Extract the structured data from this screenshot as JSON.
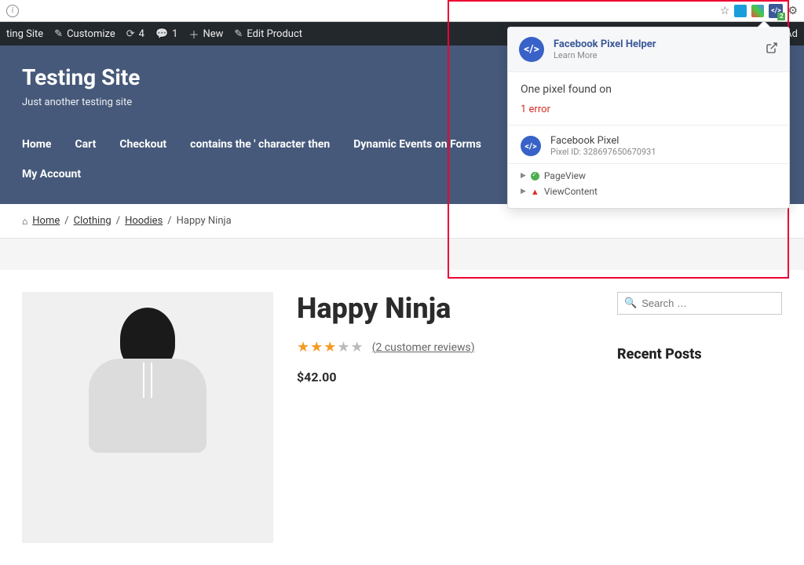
{
  "browser": {
    "pixel_ext_count": "2"
  },
  "admin_bar": {
    "site": "ting Site",
    "customize": "Customize",
    "updates": "4",
    "comments": "1",
    "new": "New",
    "edit": "Edit Product",
    "howdy": "y, Ad"
  },
  "site": {
    "title": "Testing Site",
    "tagline": "Just another testing site",
    "nav": [
      "Home",
      "Cart",
      "Checkout",
      "contains the ' character then",
      "Dynamic Events on Forms"
    ],
    "nav2": [
      "My Account"
    ]
  },
  "breadcrumb": {
    "home": "Home",
    "clothing": "Clothing",
    "hoodies": "Hoodies",
    "current": "Happy Ninja"
  },
  "product": {
    "title": "Happy Ninja",
    "review_link": "(2 customer reviews)",
    "price": "$42.00",
    "rating_full": 3,
    "rating_total": 5
  },
  "sidebar": {
    "search_placeholder": "Search …",
    "recent_posts": "Recent Posts"
  },
  "popup": {
    "title": "Facebook Pixel Helper",
    "learn": "Learn More",
    "found": "One pixel found on",
    "error": "1 error",
    "pixel_label": "Facebook Pixel",
    "pixel_id_label": "Pixel ID: 328697650670931",
    "events": [
      {
        "status": "ok",
        "name": "PageView"
      },
      {
        "status": "warn",
        "name": "ViewContent"
      }
    ]
  }
}
